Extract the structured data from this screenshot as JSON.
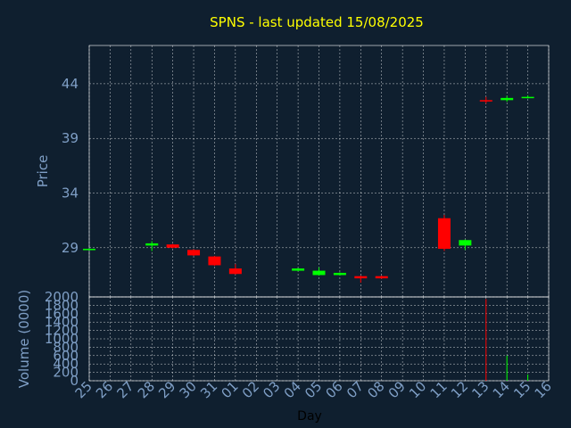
{
  "chart_data": {
    "type": "candlestick",
    "title": "SPNS - last updated 15/08/2025",
    "xlabel": "Day",
    "price_ylabel": "Price",
    "volume_ylabel": "Volume (0000)",
    "x_ticks": [
      "25",
      "26",
      "27",
      "28",
      "29",
      "30",
      "31",
      "01",
      "02",
      "03",
      "04",
      "05",
      "06",
      "07",
      "08",
      "09",
      "10",
      "11",
      "12",
      "13",
      "14",
      "15",
      "16"
    ],
    "price_ticks": [
      29,
      34,
      39,
      44
    ],
    "price_ylim": [
      24.5,
      47.5
    ],
    "volume_ticks": [
      0,
      200,
      400,
      600,
      800,
      1000,
      1200,
      1400,
      1600,
      1800,
      2000
    ],
    "volume_ylim": [
      0,
      2000
    ],
    "grid": true,
    "colors": {
      "background": "#0f1f2f",
      "plot_border": "#ffffff",
      "grid": "#ffffff",
      "up": "#00ff00",
      "down": "#ff0000",
      "title": "#ffff00",
      "axis_text": "#7f9fc6",
      "xlabel_text": "#000000"
    },
    "candles": [
      {
        "day": "25",
        "open": 28.8,
        "close": 28.9,
        "high": 28.95,
        "low": 28.75
      },
      {
        "day": "28",
        "open": 29.2,
        "close": 29.4,
        "high": 29.6,
        "low": 28.7
      },
      {
        "day": "29",
        "open": 29.3,
        "close": 29.0,
        "high": 29.35,
        "low": 28.95
      },
      {
        "day": "30",
        "open": 28.8,
        "close": 28.3,
        "high": 28.85,
        "low": 28.25
      },
      {
        "day": "31",
        "open": 28.2,
        "close": 27.4,
        "high": 28.25,
        "low": 27.35
      },
      {
        "day": "01",
        "open": 27.1,
        "close": 26.6,
        "high": 27.5,
        "low": 26.55
      },
      {
        "day": "04",
        "open": 26.9,
        "close": 27.1,
        "high": 27.15,
        "low": 26.85
      },
      {
        "day": "05",
        "open": 26.5,
        "close": 26.9,
        "high": 27.2,
        "low": 26.45
      },
      {
        "day": "06",
        "open": 26.5,
        "close": 26.7,
        "high": 26.75,
        "low": 26.45
      },
      {
        "day": "07",
        "open": 26.4,
        "close": 26.2,
        "high": 26.45,
        "low": 25.8
      },
      {
        "day": "08",
        "open": 26.4,
        "close": 26.2,
        "high": 26.45,
        "low": 26.15
      },
      {
        "day": "11",
        "open": 31.7,
        "close": 28.9,
        "high": 32.0,
        "low": 28.7
      },
      {
        "day": "12",
        "open": 29.2,
        "close": 29.7,
        "high": 29.75,
        "low": 28.8
      },
      {
        "day": "13",
        "open": 42.5,
        "close": 42.4,
        "high": 42.8,
        "low": 42.2
      },
      {
        "day": "14",
        "open": 42.5,
        "close": 42.7,
        "high": 42.9,
        "low": 42.35
      },
      {
        "day": "15",
        "open": 42.7,
        "close": 42.8,
        "high": 42.95,
        "low": 42.65
      }
    ],
    "volume": [
      {
        "day": "13",
        "value": 1950,
        "color": "down"
      },
      {
        "day": "14",
        "value": 600,
        "color": "up"
      },
      {
        "day": "15",
        "value": 150,
        "color": "up"
      }
    ]
  }
}
